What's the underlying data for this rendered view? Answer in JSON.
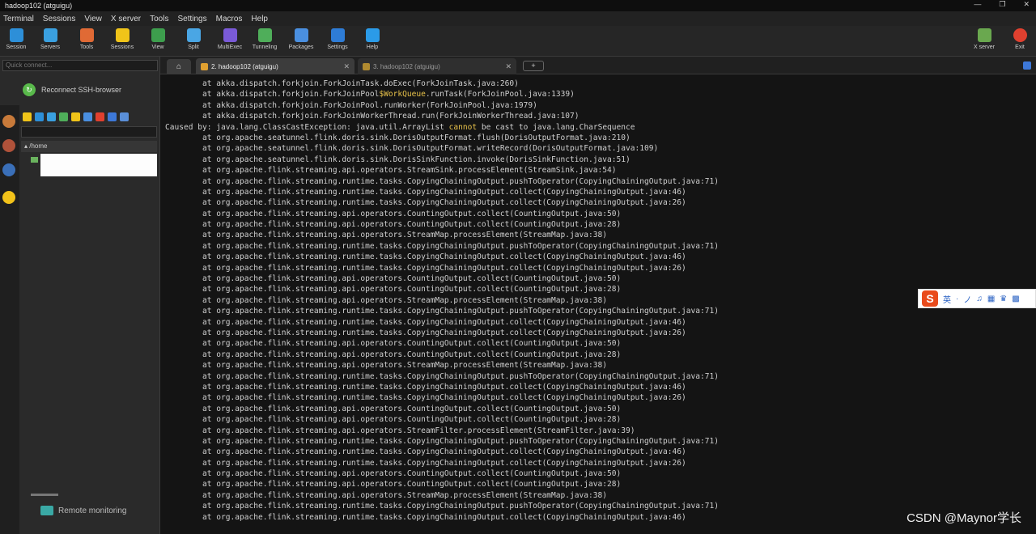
{
  "window": {
    "title": "hadoop102 (atguigu)"
  },
  "menu": [
    "Terminal",
    "Sessions",
    "View",
    "X server",
    "Tools",
    "Settings",
    "Macros",
    "Help"
  ],
  "toolbar": {
    "left": [
      {
        "label": "Session",
        "icon": "session-icon",
        "color": "#2d8fd8"
      },
      {
        "label": "Servers",
        "icon": "servers-icon",
        "color": "#3aa0e0"
      },
      {
        "label": "Tools",
        "icon": "tools-icon",
        "color": "#e06a35"
      },
      {
        "label": "Sessions",
        "icon": "star-icon",
        "color": "#f0c419"
      },
      {
        "label": "View",
        "icon": "view-icon",
        "color": "#3d9e4d"
      },
      {
        "label": "Split",
        "icon": "split-icon",
        "color": "#4aa6e4"
      },
      {
        "label": "MultiExec",
        "icon": "multiexec-icon",
        "color": "#7a5ad8"
      },
      {
        "label": "Tunneling",
        "icon": "tunneling-icon",
        "color": "#4fae5a"
      },
      {
        "label": "Packages",
        "icon": "packages-icon",
        "color": "#4a8fe0"
      },
      {
        "label": "Settings",
        "icon": "settings-icon",
        "color": "#2e7cd6"
      },
      {
        "label": "Help",
        "icon": "help-icon",
        "color": "#2b9be8"
      }
    ],
    "right": [
      {
        "label": "X server",
        "icon": "x-server-icon",
        "color": "#6aa84f"
      },
      {
        "label": "Exit",
        "icon": "exit-icon",
        "color": "#e0402f"
      }
    ]
  },
  "sidebar": {
    "quick_connect_placeholder": "Quick connect...",
    "reconnect_label": "Reconnect SSH-browser",
    "tree_root": "/home",
    "remote_monitoring": "Remote monitoring"
  },
  "tabs": [
    {
      "label": "2. hadoop102 (atguigu)",
      "active": true
    },
    {
      "label": "3. hadoop102 (atguigu)",
      "active": false
    }
  ],
  "terminal_lines": [
    "        at akka.dispatch.forkjoin.ForkJoinTask.doExec(ForkJoinTask.java:260)",
    "        at akka.dispatch.forkjoin.ForkJoinPool$WorkQueue.runTask(ForkJoinPool.java:1339)",
    "        at akka.dispatch.forkjoin.ForkJoinPool.runWorker(ForkJoinPool.java:1979)",
    "        at akka.dispatch.forkjoin.ForkJoinWorkerThread.run(ForkJoinWorkerThread.java:107)",
    "Caused by: java.lang.ClassCastException: java.util.ArrayList cannot be cast to java.lang.CharSequence",
    "        at org.apache.seatunnel.flink.doris.sink.DorisOutputFormat.flush(DorisOutputFormat.java:210)",
    "        at org.apache.seatunnel.flink.doris.sink.DorisOutputFormat.writeRecord(DorisOutputFormat.java:109)",
    "        at org.apache.seatunnel.flink.doris.sink.DorisSinkFunction.invoke(DorisSinkFunction.java:51)",
    "        at org.apache.flink.streaming.api.operators.StreamSink.processElement(StreamSink.java:54)",
    "        at org.apache.flink.streaming.runtime.tasks.CopyingChainingOutput.pushToOperator(CopyingChainingOutput.java:71)",
    "        at org.apache.flink.streaming.runtime.tasks.CopyingChainingOutput.collect(CopyingChainingOutput.java:46)",
    "        at org.apache.flink.streaming.runtime.tasks.CopyingChainingOutput.collect(CopyingChainingOutput.java:26)",
    "        at org.apache.flink.streaming.api.operators.CountingOutput.collect(CountingOutput.java:50)",
    "        at org.apache.flink.streaming.api.operators.CountingOutput.collect(CountingOutput.java:28)",
    "        at org.apache.flink.streaming.api.operators.StreamMap.processElement(StreamMap.java:38)",
    "        at org.apache.flink.streaming.runtime.tasks.CopyingChainingOutput.pushToOperator(CopyingChainingOutput.java:71)",
    "        at org.apache.flink.streaming.runtime.tasks.CopyingChainingOutput.collect(CopyingChainingOutput.java:46)",
    "        at org.apache.flink.streaming.runtime.tasks.CopyingChainingOutput.collect(CopyingChainingOutput.java:26)",
    "        at org.apache.flink.streaming.api.operators.CountingOutput.collect(CountingOutput.java:50)",
    "        at org.apache.flink.streaming.api.operators.CountingOutput.collect(CountingOutput.java:28)",
    "        at org.apache.flink.streaming.api.operators.StreamMap.processElement(StreamMap.java:38)",
    "        at org.apache.flink.streaming.runtime.tasks.CopyingChainingOutput.pushToOperator(CopyingChainingOutput.java:71)",
    "        at org.apache.flink.streaming.runtime.tasks.CopyingChainingOutput.collect(CopyingChainingOutput.java:46)",
    "        at org.apache.flink.streaming.runtime.tasks.CopyingChainingOutput.collect(CopyingChainingOutput.java:26)",
    "        at org.apache.flink.streaming.api.operators.CountingOutput.collect(CountingOutput.java:50)",
    "        at org.apache.flink.streaming.api.operators.CountingOutput.collect(CountingOutput.java:28)",
    "        at org.apache.flink.streaming.api.operators.StreamMap.processElement(StreamMap.java:38)",
    "        at org.apache.flink.streaming.runtime.tasks.CopyingChainingOutput.pushToOperator(CopyingChainingOutput.java:71)",
    "        at org.apache.flink.streaming.runtime.tasks.CopyingChainingOutput.collect(CopyingChainingOutput.java:46)",
    "        at org.apache.flink.streaming.runtime.tasks.CopyingChainingOutput.collect(CopyingChainingOutput.java:26)",
    "        at org.apache.flink.streaming.api.operators.CountingOutput.collect(CountingOutput.java:50)",
    "        at org.apache.flink.streaming.api.operators.CountingOutput.collect(CountingOutput.java:28)",
    "        at org.apache.flink.streaming.api.operators.StreamFilter.processElement(StreamFilter.java:39)",
    "        at org.apache.flink.streaming.runtime.tasks.CopyingChainingOutput.pushToOperator(CopyingChainingOutput.java:71)",
    "        at org.apache.flink.streaming.runtime.tasks.CopyingChainingOutput.collect(CopyingChainingOutput.java:46)",
    "        at org.apache.flink.streaming.runtime.tasks.CopyingChainingOutput.collect(CopyingChainingOutput.java:26)",
    "        at org.apache.flink.streaming.api.operators.CountingOutput.collect(CountingOutput.java:50)",
    "        at org.apache.flink.streaming.api.operators.CountingOutput.collect(CountingOutput.java:28)",
    "        at org.apache.flink.streaming.api.operators.StreamMap.processElement(StreamMap.java:38)",
    "        at org.apache.flink.streaming.runtime.tasks.CopyingChainingOutput.pushToOperator(CopyingChainingOutput.java:71)",
    "        at org.apache.flink.streaming.runtime.tasks.CopyingChainingOutput.collect(CopyingChainingOutput.java:46)"
  ],
  "ime": {
    "logo": "S",
    "items": [
      "英",
      "·",
      "ノ",
      "♫",
      "▦",
      "♛",
      "▩"
    ]
  },
  "watermark": "CSDN @Maynor学长"
}
